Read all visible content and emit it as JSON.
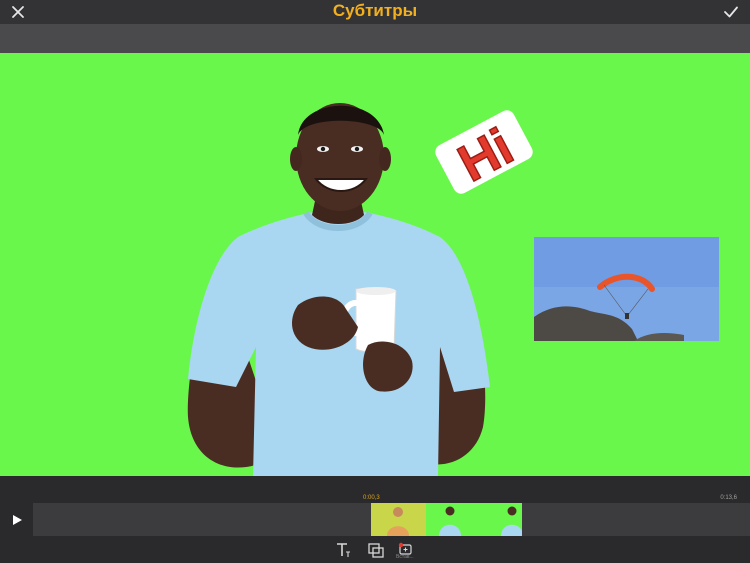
{
  "header": {
    "title": "Субтитры"
  },
  "preview": {
    "sticker_text": "Hi",
    "background_color": "#6af74b"
  },
  "timeline": {
    "current_time": "0:00,3",
    "total_time": "0:13,6"
  },
  "toolbar": {
    "insert_label": "Встав..."
  },
  "icons": {
    "close": "close-icon",
    "confirm": "checkmark-icon",
    "play": "play-icon",
    "text": "text-icon",
    "overlay": "overlay-icon",
    "insert": "insert-icon"
  },
  "colors": {
    "accent": "#f2b01e",
    "sticker_red": "#e23b2e",
    "topbar": "#333336"
  }
}
